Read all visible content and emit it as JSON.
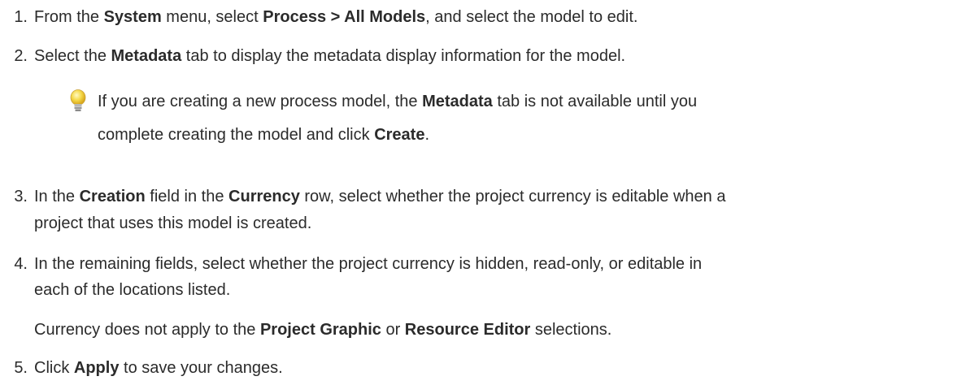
{
  "steps": [
    {
      "num": "1.",
      "lines": [
        [
          {
            "t": "From the "
          },
          {
            "t": "System",
            "b": true
          },
          {
            "t": " menu, select "
          },
          {
            "t": "Process > All Models",
            "b": true
          },
          {
            "t": ", and select the model to edit."
          }
        ]
      ]
    },
    {
      "num": "2.",
      "lines": [
        [
          {
            "t": "Select the "
          },
          {
            "t": "Metadata",
            "b": true
          },
          {
            "t": " tab to display the metadata display information for the model."
          }
        ]
      ]
    },
    {
      "num": "3.",
      "lines": [
        [
          {
            "t": "In the "
          },
          {
            "t": "Creation",
            "b": true
          },
          {
            "t": " field in the "
          },
          {
            "t": "Currency",
            "b": true
          },
          {
            "t": " row, select whether the project currency is editable when a"
          }
        ],
        [
          {
            "t": "project that uses this model is created."
          }
        ]
      ]
    },
    {
      "num": "4.",
      "lines": [
        [
          {
            "t": "In the remaining fields, select whether the project currency is hidden, read-only, or editable in"
          }
        ],
        [
          {
            "t": "each of the locations listed."
          }
        ]
      ]
    },
    {
      "num": "5.",
      "lines": [
        [
          {
            "t": "Click "
          },
          {
            "t": "Apply",
            "b": true
          },
          {
            "t": " to save your changes."
          }
        ]
      ]
    }
  ],
  "tip": {
    "icon": "lightbulb-icon",
    "lines": [
      [
        {
          "t": "If you are creating a new process model, the "
        },
        {
          "t": "Metadata",
          "b": true
        },
        {
          "t": " tab is not available until you"
        }
      ],
      [
        {
          "t": "complete creating the model and click "
        },
        {
          "t": "Create",
          "b": true
        },
        {
          "t": "."
        }
      ]
    ]
  },
  "note": [
    {
      "t": "Currency does not apply to the "
    },
    {
      "t": "Project Graphic",
      "b": true
    },
    {
      "t": " or "
    },
    {
      "t": "Resource Editor",
      "b": true
    },
    {
      "t": " selections."
    }
  ]
}
